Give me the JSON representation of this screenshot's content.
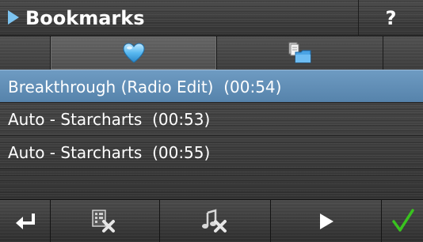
{
  "header": {
    "title": "Bookmarks",
    "help_label": "?",
    "accent": "#7cc3f0"
  },
  "tabs": [
    {
      "icon": "heart-icon",
      "selected": true
    },
    {
      "icon": "folder-files-icon",
      "selected": false
    }
  ],
  "list": {
    "items": [
      {
        "label": "Breakthrough (Radio Edit)  (00:54)",
        "selected": true
      },
      {
        "label": "Auto - Starcharts  (00:53)",
        "selected": false
      },
      {
        "label": "Auto - Starcharts  (00:55)",
        "selected": false
      }
    ],
    "selected_color": "#6591b9"
  },
  "toolbar": {
    "buttons": [
      {
        "icon": "return-arrow-icon"
      },
      {
        "icon": "delete-entry-icon"
      },
      {
        "icon": "delete-music-icon"
      },
      {
        "icon": "play-icon"
      },
      {
        "icon": "checkmark-icon"
      }
    ]
  }
}
